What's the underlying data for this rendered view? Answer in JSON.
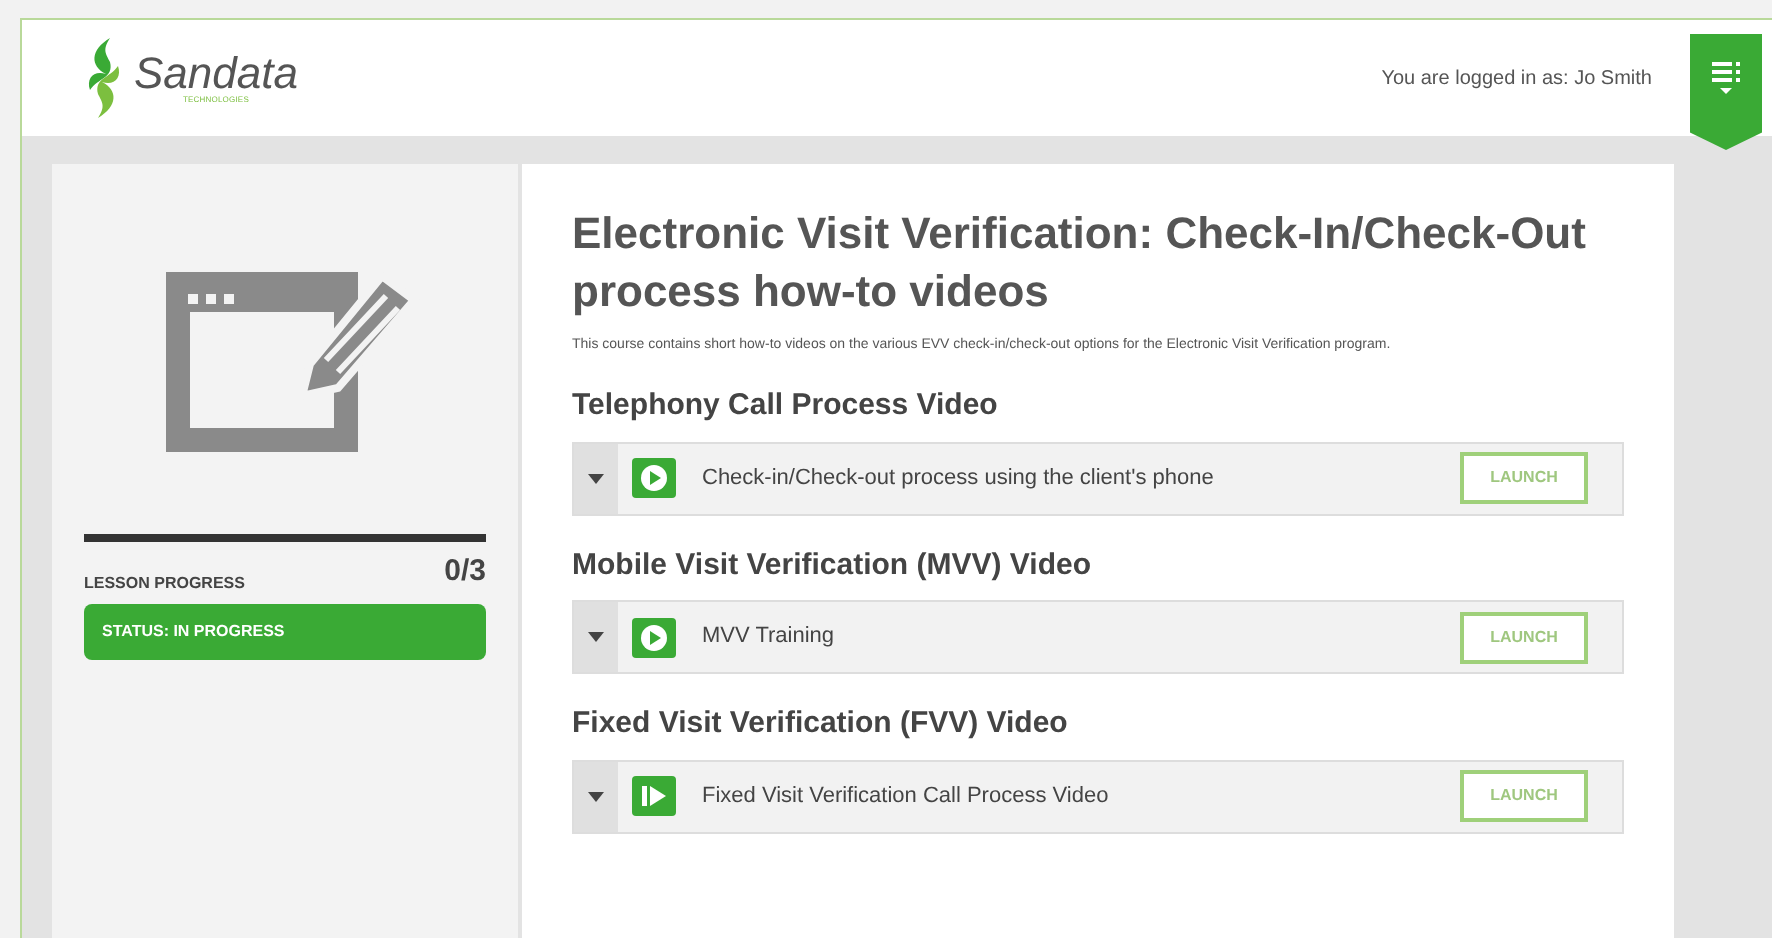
{
  "header": {
    "logo": "Sandata",
    "logo_tagline": "TECHNOLOGIES",
    "user_label": "You are logged in as: Jo Smith"
  },
  "sidebar": {
    "progress_label": "LESSON PROGRESS",
    "progress_count": "0/3",
    "status": "STATUS: IN PROGRESS"
  },
  "course": {
    "title": "Electronic Visit Verification: Check-In/Check-Out process how-to videos",
    "description": "This course contains short how-to videos on the various EVV check-in/check-out options for the Electronic Visit Verification program.",
    "sections": [
      {
        "heading": "Telephony Call Process Video",
        "item": {
          "kind": "play",
          "label": "Check-in/Check-out process using the client's phone",
          "button": "LAUNCH"
        }
      },
      {
        "heading": "Mobile Visit Verification (MVV) Video",
        "item": {
          "kind": "play",
          "label": "MVV Training",
          "button": "LAUNCH"
        }
      },
      {
        "heading": "Fixed Visit Verification (FVV) Video",
        "item": {
          "kind": "step",
          "label": "Fixed Visit Verification Call Process Video",
          "button": "LAUNCH"
        }
      }
    ]
  }
}
